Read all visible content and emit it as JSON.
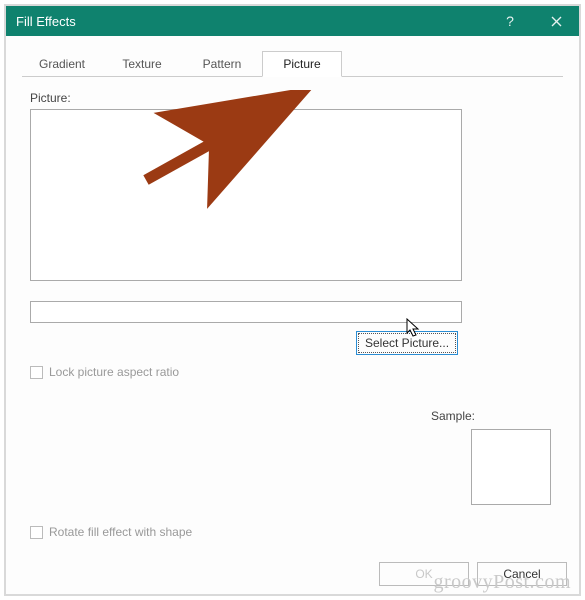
{
  "title": "Fill Effects",
  "tabs": {
    "gradient": "Gradient",
    "texture": "Texture",
    "pattern": "Pattern",
    "picture": "Picture"
  },
  "picture_label": "Picture:",
  "select_picture_btn": "Select Picture...",
  "lock_aspect": "Lock picture aspect ratio",
  "rotate_fill": "Rotate fill effect with shape",
  "sample_label": "Sample:",
  "ok_btn": "OK",
  "cancel_btn": "Cancel",
  "watermark": "groovyPost.com"
}
